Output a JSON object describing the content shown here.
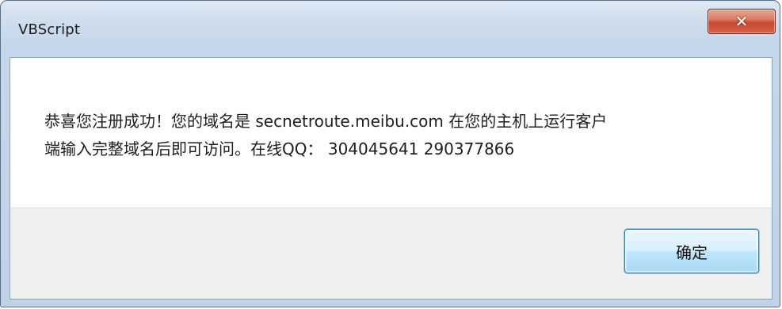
{
  "window": {
    "title": "VBScript"
  },
  "titlebar": {
    "close_icon": "close-icon",
    "close_glyph": "✕"
  },
  "dialog": {
    "message_line1": "恭喜您注册成功！您的域名是 secnetroute.meibu.com  在您的主机上运行客户",
    "message_line2": "端输入完整域名后即可访问。在线QQ： 304045641 290377866",
    "ok_label": "确定"
  },
  "colors": {
    "close_button": "#c74a33",
    "ok_button_border": "#3c7fb1"
  }
}
